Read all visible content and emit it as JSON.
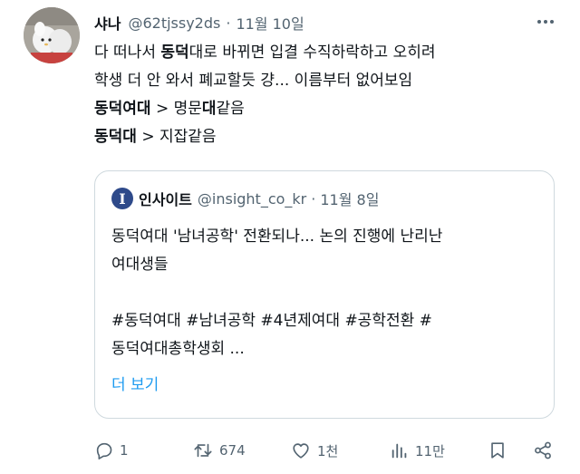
{
  "tweet": {
    "author_name": "샤나",
    "author_handle": "@62tjssy2ds",
    "separator": "·",
    "date": "11월 10일",
    "line1": "다 떠나서 ",
    "line1_bold": "동덕",
    "line1_rest": "대로 바뀌면 입결 수직하락하고 오히려",
    "line2": "학생 더 안 와서 폐교할듯 걍... 이름부터 없어보임",
    "line3_bold": "동덕여대",
    "line3_mid": " > 명문",
    "line3_bold2": "대",
    "line3_rest": "같음",
    "line4_bold": "동덕대",
    "line4_rest": " > 지잡같음"
  },
  "quote": {
    "logo_letter": "I",
    "name": "인사이트",
    "handle": "@insight_co_kr",
    "separator": "·",
    "date": "11월 8일",
    "line1": "동덕여대 '남녀공학' 전환되나... 논의 진행에 난리난",
    "line2": "여대생들",
    "line3": "#동덕여대 #남녀공학 #4년제여대 #공학전환 #",
    "line4": "동덕여대총학생회 ...",
    "show_more": "더 보기"
  },
  "actions": {
    "reply_count": "1",
    "retweet_count": "674",
    "like_count": "1천",
    "view_count": "11만"
  },
  "colors": {
    "text": "#0f1419",
    "secondary": "#536471",
    "link": "#1d9bf0",
    "border": "#cfd9de",
    "insight_logo": "#2e4a8a"
  },
  "icons": [
    "avatar-image",
    "more-icon",
    "insight-logo-icon",
    "reply-icon",
    "retweet-icon",
    "like-icon",
    "views-icon",
    "bookmark-icon",
    "share-icon"
  ]
}
